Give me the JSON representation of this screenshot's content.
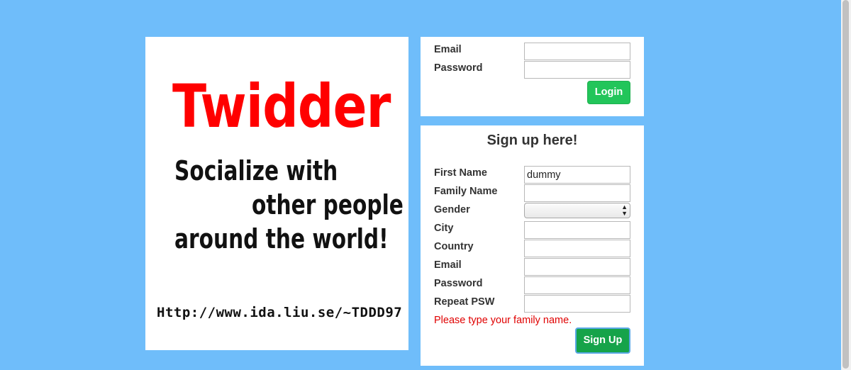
{
  "welcome": {
    "title": "Twidder",
    "slogan_line1": "Socialize with",
    "slogan_line2": "other people",
    "slogan_line3": "around the world!",
    "url": "Http://www.ida.liu.se/~TDDD97"
  },
  "login": {
    "email_label": "Email",
    "email_value": "",
    "password_label": "Password",
    "password_value": "",
    "button_label": "Login"
  },
  "signup": {
    "title": "Sign up here!",
    "first_name_label": "First Name",
    "first_name_value": "dummy",
    "family_name_label": "Family Name",
    "family_name_value": "",
    "gender_label": "Gender",
    "gender_value": "",
    "city_label": "City",
    "city_value": "",
    "country_label": "Country",
    "country_value": "",
    "email_label": "Email",
    "email_value": "",
    "password_label": "Password",
    "password_value": "",
    "repeat_password_label": "Repeat PSW",
    "repeat_password_value": "",
    "error_message": "Please type your family name.",
    "button_label": "Sign Up"
  },
  "colors": {
    "page_background": "#6fbdfa",
    "logo_red": "#ff0000",
    "error_red": "#e00000",
    "button_green": "#22c55a",
    "signup_button_green": "#16a34a"
  },
  "icons": {
    "gender_select": "select-arrows-icon"
  }
}
